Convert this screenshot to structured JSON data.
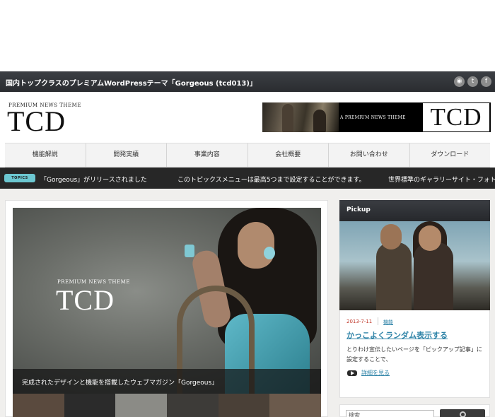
{
  "header": {
    "tagline": "国内トップクラスのプレミアムWordPressテーマ「Gorgeous (tcd013)」",
    "social": [
      {
        "name": "rss-icon",
        "glyph": "◉"
      },
      {
        "name": "twitter-icon",
        "glyph": "t"
      },
      {
        "name": "facebook-icon",
        "glyph": "f"
      }
    ]
  },
  "logo": {
    "sub": "PREMIUM NEWS THEME",
    "main": "TCD"
  },
  "banner": {
    "sub": "A PREMIUM NEWS THEME",
    "main": "TCD"
  },
  "nav": {
    "items": [
      "機能解説",
      "開発実績",
      "事業内容",
      "会社概要",
      "お問い合わせ",
      "ダウンロード"
    ]
  },
  "topics": {
    "badge": "TOPICS",
    "items": [
      "「Gorgeous」がリリースされました",
      "このトピックスメニューは最高5つまで設定することができます。",
      "世界標準のギャラリーサイト・フォト"
    ]
  },
  "slider": {
    "logo_sub": "PREMIUM NEWS THEME",
    "logo_main": "TCD",
    "caption": "完成されたデザインと機能を搭載したウェブマガジン「Gorgeous」",
    "thumb_colors": [
      "#5a4a3e",
      "#2b2b2b",
      "#8b8b86",
      "#3d3b38",
      "#4a4037",
      "#6b5a4c"
    ]
  },
  "pickup": {
    "heading": "Pickup",
    "date": "2013-7-11",
    "category": "機能",
    "title": "かっこよくランダム表示する",
    "description": "とりわけ宣伝したいページを「ピックアップ記事」に設定することで、",
    "more": "詳細を見る"
  },
  "search": {
    "value": "検索"
  },
  "colors": {
    "topbar": "#2f3236",
    "accent": "#2f84a8",
    "topics_badge": "#6cc7d1",
    "date": "#c0392b"
  }
}
